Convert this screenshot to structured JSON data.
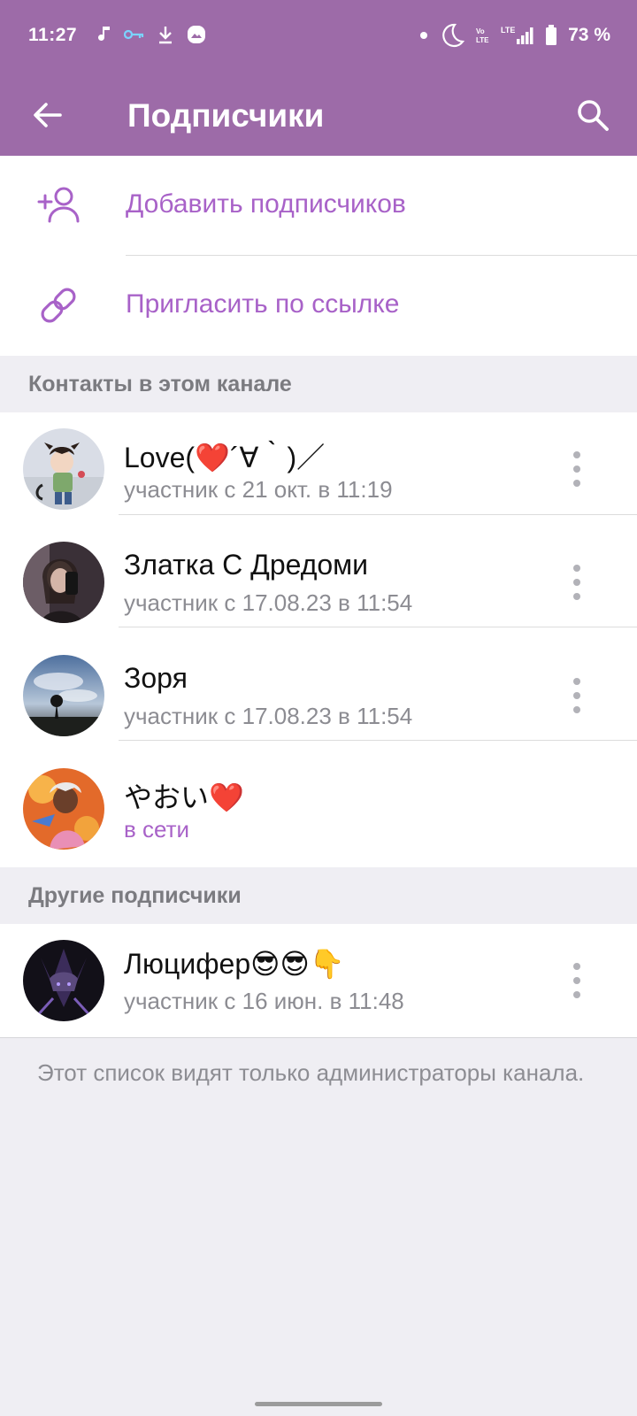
{
  "status_bar": {
    "time": "11:27",
    "battery": "73 %",
    "left_icons": [
      "music-note-icon",
      "key-icon",
      "download-icon",
      "gallery-icon"
    ],
    "right_icons": [
      "dot-icon",
      "moon-icon",
      "volte-icon",
      "lte-signal-icon",
      "battery-icon"
    ]
  },
  "app_bar": {
    "title": "Подписчики",
    "background": "#9d6ba8"
  },
  "actions": [
    {
      "label": "Добавить подписчиков",
      "icon": "add-user-icon"
    },
    {
      "label": "Пригласить по ссылке",
      "icon": "link-icon"
    }
  ],
  "accent_color": "#a862c8",
  "sections": {
    "contacts_header": "Контакты в этом канале",
    "others_header": "Другие подписчики"
  },
  "contacts": [
    {
      "name": "Love(❤️´∀｀)／",
      "status": "участник с 21 окт. в 11:19",
      "online": false
    },
    {
      "name": "Златка С Дредоми",
      "status": "участник с 17.08.23 в 11:54",
      "online": false
    },
    {
      "name": "Зоря",
      "status": "участник с 17.08.23 в 11:54",
      "online": false
    },
    {
      "name": "やおい❤️",
      "status": "в сети",
      "online": true
    }
  ],
  "others": [
    {
      "name": "Люцифер😎😎👇",
      "status": "участник с 16 июн. в 11:48",
      "online": false
    }
  ],
  "footer_note": "Этот список видят только администраторы канала."
}
